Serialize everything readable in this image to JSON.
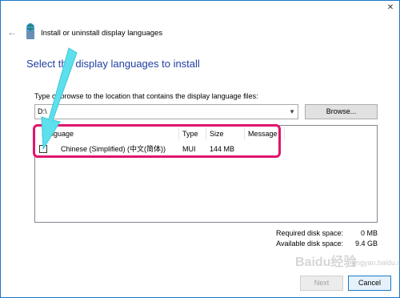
{
  "window": {
    "title": "Install or uninstall display languages",
    "close_glyph": "✕",
    "back_glyph": "←"
  },
  "page": {
    "heading": "Select the display languages to install",
    "instruction": "Type or browse to the location that contains the display language files:",
    "path_value": "D:\\",
    "browse_label": "Browse..."
  },
  "table": {
    "headers": [
      "Language",
      "Type",
      "Size",
      "Message"
    ],
    "rows": [
      {
        "language": "Chinese (Simplified) (中文(简体))",
        "type": "MUI",
        "size": "144 MB",
        "checked": false
      }
    ]
  },
  "disk": {
    "required_label": "Required disk space:",
    "required_value": "0 MB",
    "available_label": "Available disk space:",
    "available_value": "9.4 GB"
  },
  "footer": {
    "next_label": "Next",
    "cancel_label": "Cancel"
  },
  "watermark": {
    "main": "Baidu经验",
    "sub": "jingyan.baidu.com"
  },
  "colors": {
    "heading": "#1f3fa0",
    "highlight": "#e0156e",
    "annotation_arrow": "#5ce0ee",
    "accent": "#1979ca"
  }
}
